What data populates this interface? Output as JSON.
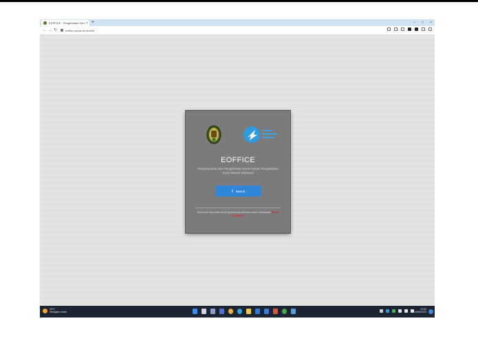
{
  "browser": {
    "tab_title": "EOFFICE - Pengelolaan Surat da...",
    "tab_close": "×",
    "new_tab": "+",
    "url": "eoffice.unpas.ac.id/auth",
    "nav": {
      "back": "←",
      "forward": "→",
      "reload": "↻"
    },
    "window_controls": {
      "minimize": "–",
      "maximize": "□",
      "close": "×"
    }
  },
  "login": {
    "app_name": "EOFFICE",
    "subtitle": "Penyimpanan dan Pengelolaan Surat Keluar Pengelolaan Surat Masuk Disposisi",
    "login_button": "Masuk",
    "help_text": "Jika Anda lupa kata sandi (password) silahkan untuk melakukan",
    "reset_link": "Reset Password"
  },
  "taskbar": {
    "weather_temp": "29°C",
    "weather_desc": "Sebagian cerah",
    "time": "13:00",
    "date": "14/06/2023"
  },
  "colors": {
    "accent_button": "#2f86d8",
    "reset_link": "#e81e1e",
    "card_bg": "#7b7b7b",
    "taskbar_bg": "#1c2333"
  }
}
